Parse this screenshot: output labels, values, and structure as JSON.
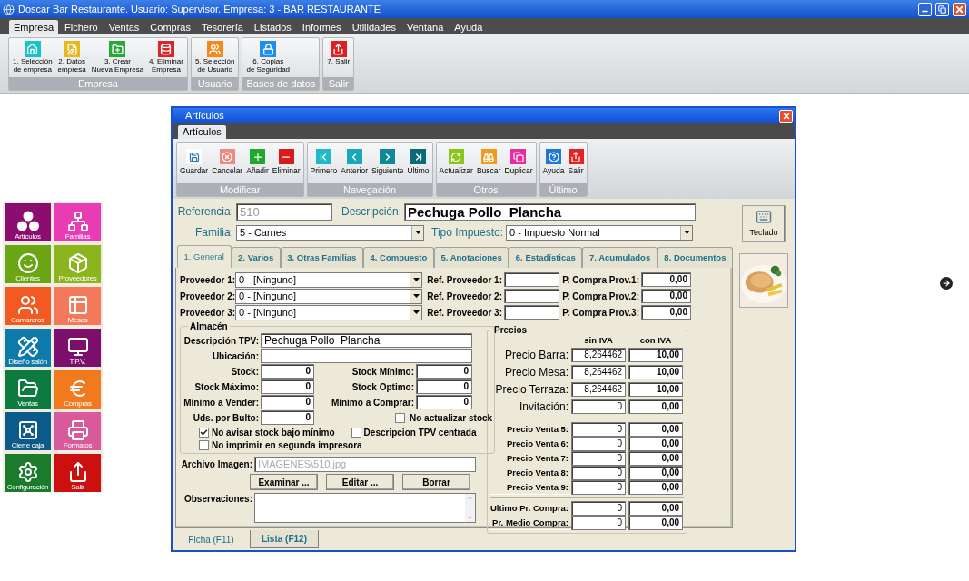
{
  "window": {
    "title": "Doscar Bar Restaurante. Usuario: Supervisor. Empresa: 3 - BAR RESTAURANTE"
  },
  "menu": [
    {
      "label": "Empresa",
      "selected": true
    },
    {
      "label": "Fichero",
      "selected": false
    },
    {
      "label": "Ventas",
      "selected": false
    },
    {
      "label": "Compras",
      "selected": false
    },
    {
      "label": "Tesorería",
      "selected": false
    },
    {
      "label": "Listados",
      "selected": false
    },
    {
      "label": "Informes",
      "selected": false
    },
    {
      "label": "Utilidades",
      "selected": false
    },
    {
      "label": "Ventana",
      "selected": false
    },
    {
      "label": "Ayuda",
      "selected": false
    }
  ],
  "ribbon": [
    {
      "label": "Empresa",
      "buttons": [
        {
          "lines": [
            "1. Selección",
            "de empresa"
          ]
        },
        {
          "lines": [
            "2. Datos",
            "empresa"
          ]
        },
        {
          "lines": [
            "3. Crear",
            "Nueva Empresa"
          ]
        },
        {
          "lines": [
            "4. Eliminar",
            "Empresa"
          ]
        }
      ]
    },
    {
      "label": "Usuario",
      "buttons": [
        {
          "lines": [
            "5. Selección",
            "de Usuario"
          ]
        }
      ]
    },
    {
      "label": "Bases de datos",
      "buttons": [
        {
          "lines": [
            "6. Copias",
            "de Seguridad"
          ]
        }
      ]
    },
    {
      "label": "Salir",
      "buttons": [
        {
          "lines": [
            "7. Salir"
          ]
        }
      ]
    }
  ],
  "launcher": [
    {
      "label": "Artículos",
      "color": "#8c0c70"
    },
    {
      "label": "Familias",
      "color": "#e83cb4"
    },
    {
      "label": "Clientes",
      "color": "#6aa514"
    },
    {
      "label": "Proveedores",
      "color": "#8cb41c"
    },
    {
      "label": "Camareros",
      "color": "#f25a22"
    },
    {
      "label": "Mesas",
      "color": "#f4795a"
    },
    {
      "label": "Diseño salón",
      "color": "#0e7aaa"
    },
    {
      "label": "T.P.V.",
      "color": "#7c0e6c"
    },
    {
      "label": "Ventas",
      "color": "#0d7a40"
    },
    {
      "label": "Compras",
      "color": "#f27a1e"
    },
    {
      "label": "Cierre caja",
      "color": "#0c5a8a"
    },
    {
      "label": "Formatos",
      "color": "#d85a9c"
    },
    {
      "label": "Configuración",
      "color": "#1b7a2c"
    },
    {
      "label": "Salir",
      "color": "#cc1010"
    }
  ],
  "dialog": {
    "title": "Artículos",
    "tabs": [
      {
        "label": "Artículos",
        "selected": true
      }
    ],
    "toolbar": [
      {
        "label": "Modificar",
        "buttons": [
          "Guardar",
          "Cancelar",
          "Añadir",
          "Eliminar"
        ]
      },
      {
        "label": "Navegación",
        "buttons": [
          "Primero",
          "Anterior",
          "Siguiente",
          "Último"
        ]
      },
      {
        "label": "Otros",
        "buttons": [
          "Actualizar",
          "Buscar",
          "Duplicar"
        ]
      },
      {
        "label": "Último",
        "buttons": [
          "Ayuda",
          "Salir"
        ]
      }
    ],
    "referencia": {
      "label": "Referencia:",
      "value": "510"
    },
    "descripcion": {
      "label": "Descripción:",
      "value": "Pechuga Pollo  Plancha"
    },
    "familia": {
      "label": "Familia:",
      "value": "5 - Carnes"
    },
    "tipo_impuesto": {
      "label": "Tipo Impuesto:",
      "value": "0 - Impuesto Normal"
    },
    "keyboard_button": "Teclado",
    "sections": [
      {
        "label": "1. General",
        "selected": true
      },
      {
        "label": "2. Varios",
        "selected": false
      },
      {
        "label": "3. Otras Familias",
        "selected": false
      },
      {
        "label": "4. Compuesto",
        "selected": false
      },
      {
        "label": "5. Anotaciones",
        "selected": false
      },
      {
        "label": "6. Estadísticas",
        "selected": false
      },
      {
        "label": "7. Acumulados",
        "selected": false
      },
      {
        "label": "8. Documentos",
        "selected": false
      }
    ],
    "proveedores": [
      {
        "label": "Proveedor 1:",
        "value": "0 - [Ninguno]",
        "ref_label": "Ref. Proveedor 1:",
        "price_label": "P. Compra Prov.1:",
        "price": "0,00"
      },
      {
        "label": "Proveedor 2:",
        "value": "0 - [Ninguno]",
        "ref_label": "Ref. Proveedor 2:",
        "price_label": "P. Compra Prov.2:",
        "price": "0,00"
      },
      {
        "label": "Proveedor 3:",
        "value": "0 - [Ninguno]",
        "ref_label": "Ref. Proveedor 3:",
        "price_label": "P. Compra Prov.3:",
        "price": "0,00"
      }
    ],
    "almacen": {
      "title": "Almacén",
      "descripcion_tpv": {
        "label": "Descripción TPV:",
        "value": "Pechuga Pollo  Plancha"
      },
      "ubicacion": {
        "label": "Ubicación:"
      },
      "rows": [
        {
          "label": "Stock:",
          "value": "0",
          "right_label": "Stock Mínimo:",
          "right_value": "0"
        },
        {
          "label": "Stock Máximo:",
          "value": "0",
          "right_label": "Stock Optimo:",
          "right_value": "0"
        },
        {
          "label": "Mínimo a Vender:",
          "value": "0",
          "right_label": "Mínimo a Comprar:",
          "right_value": "0"
        }
      ],
      "bulto": {
        "label": "Uds. por Bulto:",
        "value": "0"
      },
      "no_actualizar": {
        "label": "No actualizar stock",
        "checked": false
      },
      "checks": [
        {
          "label": "No avisar stock bajo mínimo",
          "checked": true
        },
        {
          "label": "Descripcion TPV centrada",
          "checked": false
        },
        {
          "label": "No imprimir en segunda impresora",
          "checked": false
        }
      ]
    },
    "imagen": {
      "label": "Archivo Imagen:",
      "value": "IMAGENES\\510.jpg"
    },
    "image_buttons": [
      "Examinar ...",
      "Editar ...",
      "Borrar"
    ],
    "observaciones": {
      "label": "Observaciones:"
    },
    "precios": {
      "title": "Precios",
      "columns": [
        "sin IVA",
        "con IVA"
      ],
      "groups": [
        {
          "kind": "main",
          "rows": [
            {
              "label": "Precio Barra:",
              "sin": "8,264462",
              "con": "10,00"
            },
            {
              "label": "Precio Mesa:",
              "sin": "8,264462",
              "con": "10,00"
            },
            {
              "label": "Precio Terraza:",
              "sin": "8,264462",
              "con": "10,00"
            },
            {
              "label": "Invitación:",
              "sin": "0",
              "con": "0,00"
            }
          ]
        },
        {
          "kind": "small",
          "rows": [
            {
              "label": "Precio Venta 5:",
              "sin": "0",
              "con": "0,00"
            },
            {
              "label": "Precio Venta 6:",
              "sin": "0",
              "con": "0,00"
            },
            {
              "label": "Precio Venta 7:",
              "sin": "0",
              "con": "0,00"
            },
            {
              "label": "Precio Venta 8:",
              "sin": "0",
              "con": "0,00"
            },
            {
              "label": "Precio Venta 9:",
              "sin": "0",
              "con": "0,00"
            }
          ]
        },
        {
          "kind": "small",
          "rows": [
            {
              "label": "Ultimo Pr. Compra:",
              "sin": "0",
              "con": "0,00"
            },
            {
              "label": "Pr. Medio Compra:",
              "sin": "0",
              "con": "0,00"
            }
          ]
        }
      ]
    },
    "views": [
      {
        "label": "Ficha (F11)",
        "selected": true
      },
      {
        "label": "Lista (F12)",
        "selected": false
      }
    ]
  }
}
